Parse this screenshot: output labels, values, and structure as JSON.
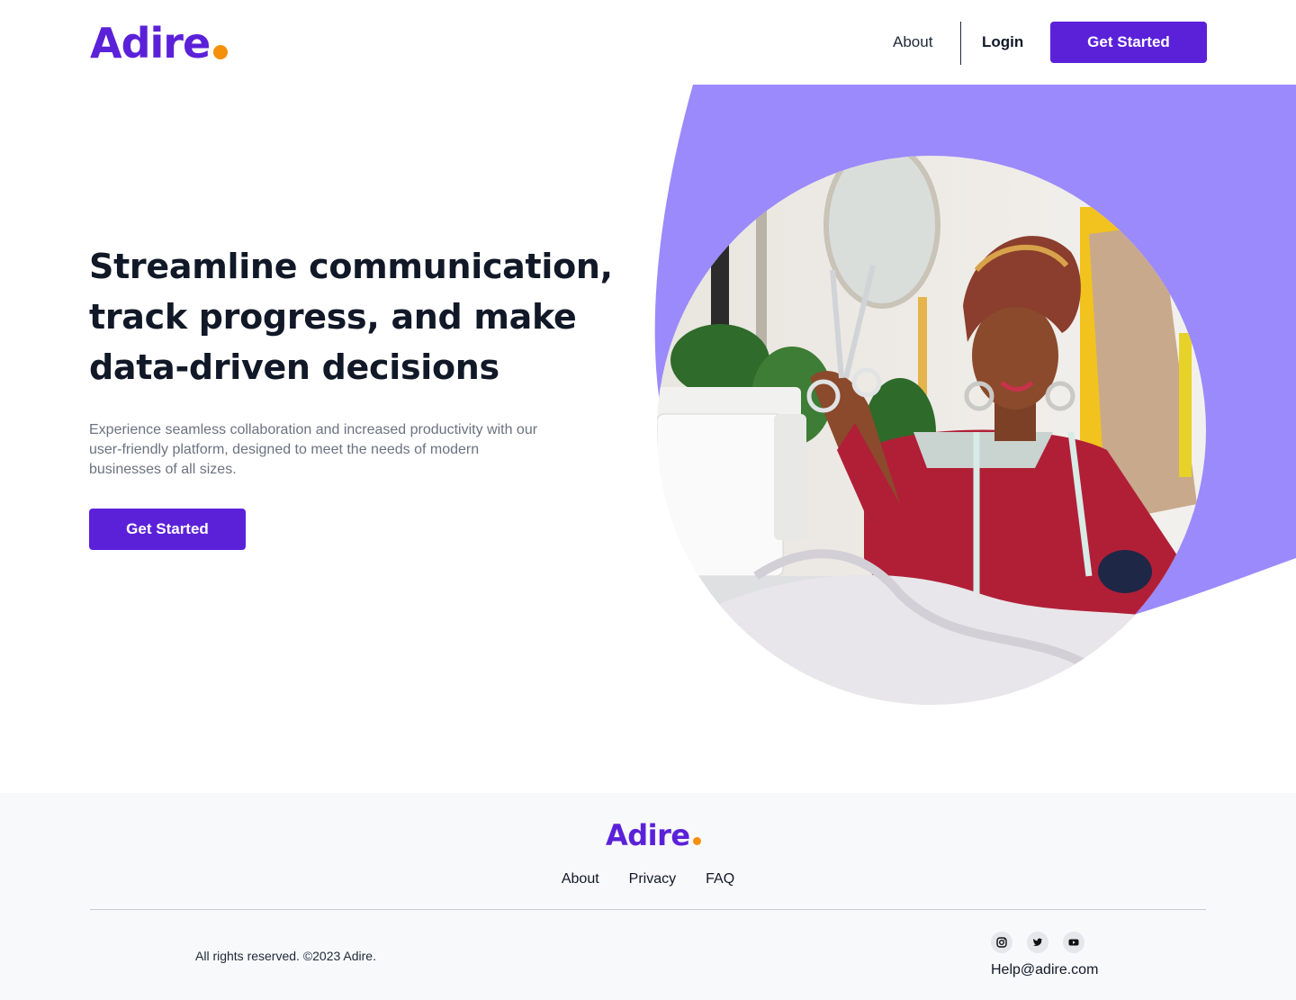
{
  "brand": {
    "name": "Adire",
    "primary_color": "#5b21d9",
    "dot_color": "#f5900b"
  },
  "header": {
    "nav_about": "About",
    "nav_login": "Login",
    "cta_label": "Get Started"
  },
  "hero": {
    "title": "Streamline communication, track progress, and make data-driven decisions",
    "subtitle": "Experience seamless collaboration and increased productivity with our user-friendly platform, designed to meet the needs of modern businesses of all sizes.",
    "cta_label": "Get Started",
    "blob_color": "#9b8afb"
  },
  "footer": {
    "logo": "Adire",
    "links": [
      "About",
      "Privacy",
      "FAQ"
    ],
    "copyright": "All rights reserved. ©2023 Adire.",
    "socials": [
      "instagram-icon",
      "twitter-icon",
      "youtube-icon"
    ],
    "help_email": "Help@adire.com"
  }
}
